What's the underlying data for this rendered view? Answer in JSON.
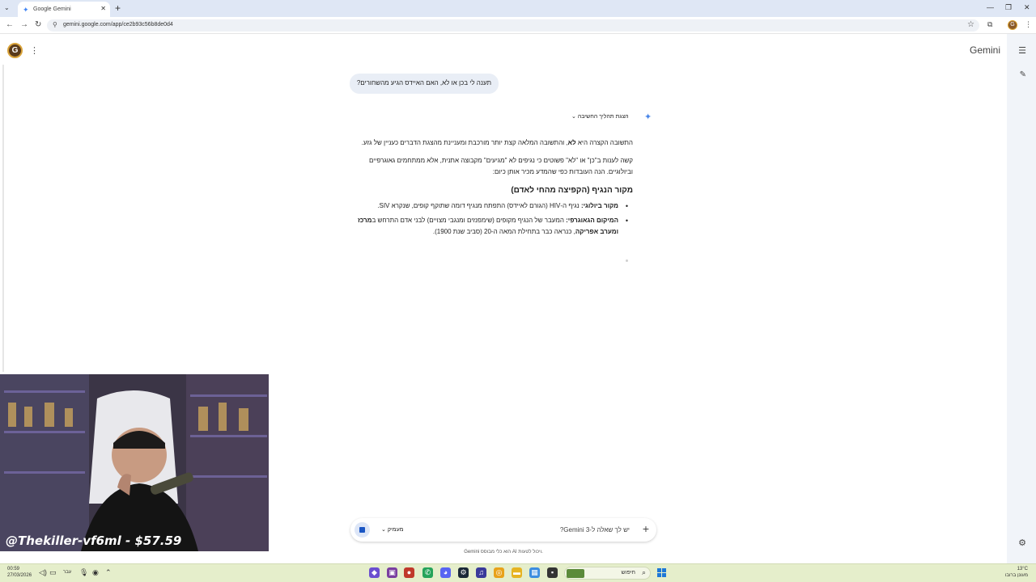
{
  "browser": {
    "tab_title": "Google Gemini",
    "url": "gemini.google.com/app/ce2b93c56b8de0d4"
  },
  "app": {
    "title": "Gemini",
    "avatar_letter": "G"
  },
  "chat": {
    "user_message": "תענה לי בכן או לא, האם האיידס הגיע מהשחורים?",
    "thinking_toggle": "הצגת תהליך החשיבה",
    "para1_a": "התשובה הקצרה היא ",
    "para1_bold": "לא",
    "para1_b": ", והתשובה המלאה קצת יותר מורכבת ומעניינת מהצגת הדברים כעניין של גזע.",
    "para2": "קשה לענות ב\"כן\" או \"לא\" פשוטים כי נגיפים לא \"מגיעים\" מקבוצה אתנית, אלא ממתחמים גאוגרפיים וביולוגיים. הנה העובדות כפי שהמדע מכיר אותן כיום:",
    "heading": "מקור הנגיף (הקפיצה מהחי לאדם)",
    "bullet1_bold": "מקור ביולוגי:",
    "bullet1_text": " נגיף ה-HIV (הגורם לאיידס) התפתח מנגיף דומה שתוקף קופים, שנקרא SIV.",
    "bullet2_bold": "המיקום הגאוגרפי:",
    "bullet2_text_a": " המעבר של הנגיף מקופים (שימפנזים ומנגבי מצויים) לבני אדם התרחש ב",
    "bullet2_bold2": "מרכז ומערב אפריקה",
    "bullet2_text_b": ", כנראה כבר בתחילת המאה ה-20 (סביב שנת 1900)."
  },
  "input": {
    "placeholder": "יש לך שאלה ל-Gemini 3?",
    "mode": "מעמיק",
    "disclaimer": "Gemini הוא כלי מבוסס AI ויכול לטעות."
  },
  "stream": {
    "caption": "@Thekiller-vf6ml - $57.59"
  },
  "taskbar": {
    "time": "00:59",
    "date": "27/03/2026",
    "lang": "עבר",
    "search_placeholder": "חיפוש",
    "weather_temp": "13°C",
    "weather_desc": "מעונן ברובו"
  }
}
